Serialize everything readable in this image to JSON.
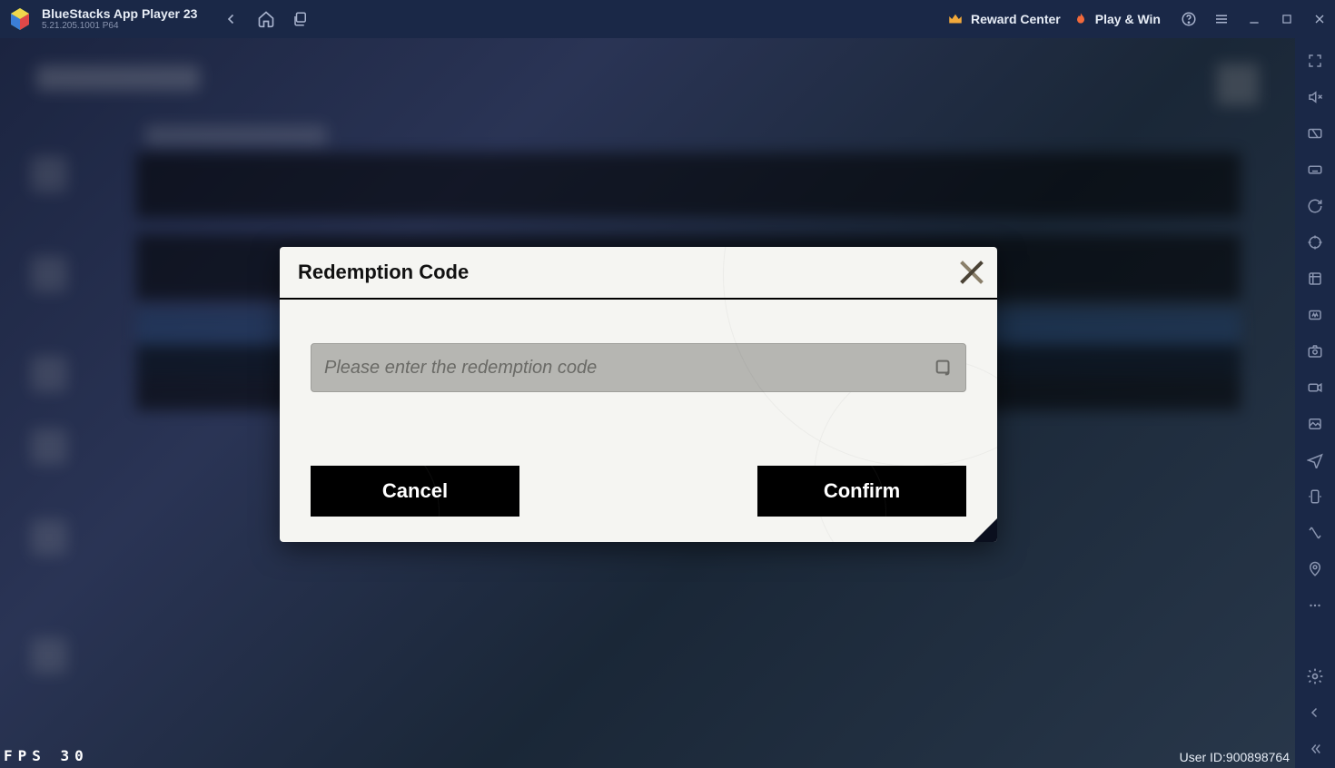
{
  "titlebar": {
    "title": "BlueStacks App Player 23",
    "subtitle": "5.21.205.1001  P64",
    "reward_label": "Reward Center",
    "playwin_label": "Play & Win"
  },
  "modal": {
    "title": "Redemption Code",
    "input_placeholder": "Please enter the redemption code",
    "cancel_label": "Cancel",
    "confirm_label": "Confirm"
  },
  "overlay": {
    "fps_label": "FPS",
    "fps_value": "30",
    "userid_label": "User ID:",
    "userid_value": "900898764"
  }
}
